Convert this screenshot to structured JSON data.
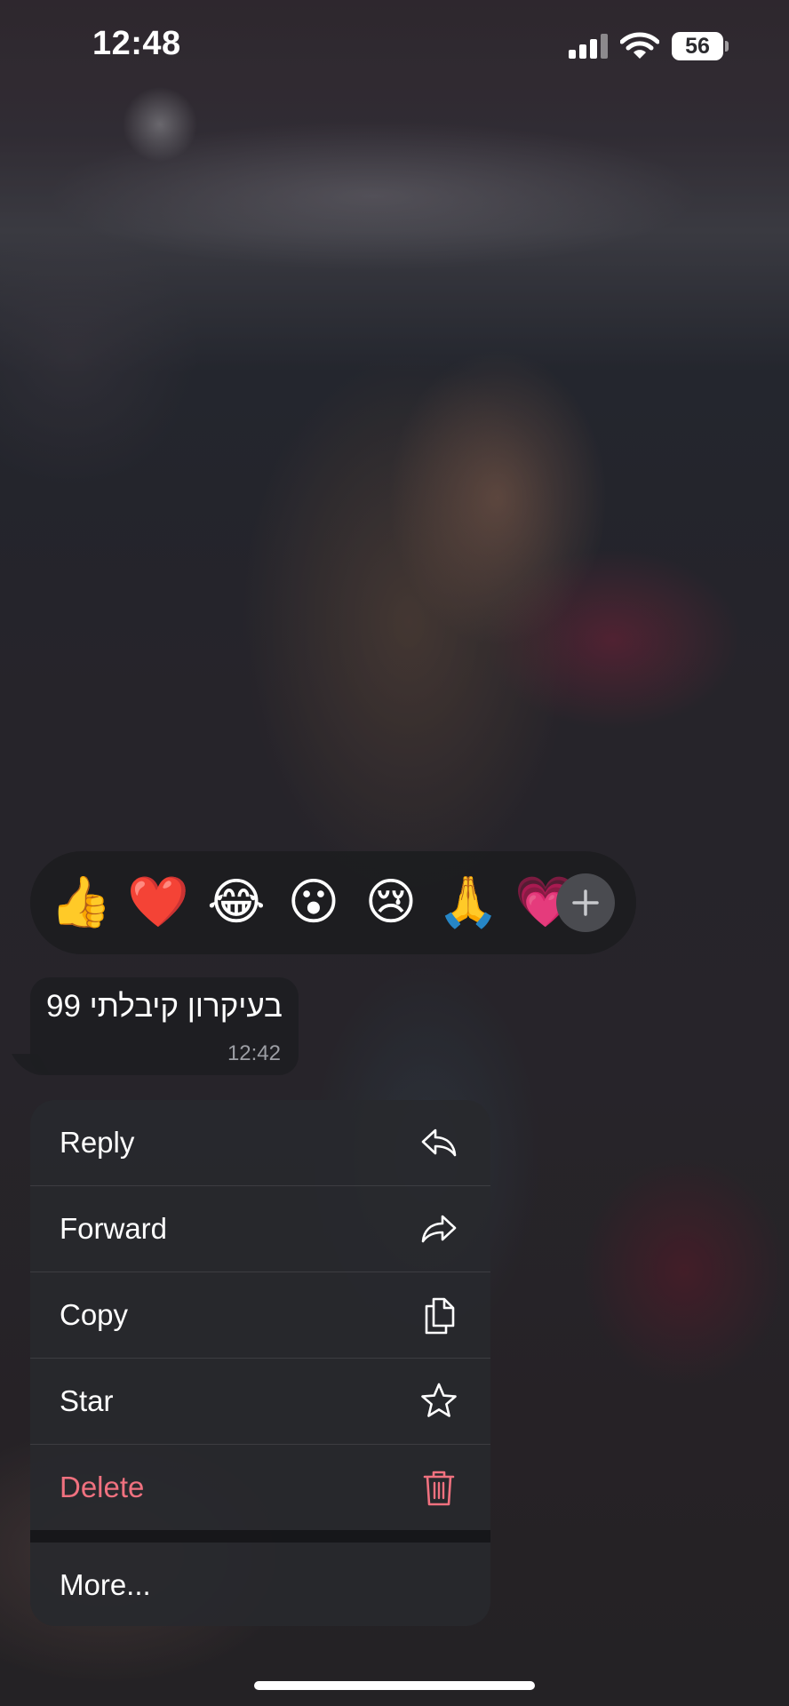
{
  "status_bar": {
    "time": "12:48",
    "battery": "56",
    "signal_icon": "cellular-signal-icon",
    "wifi_icon": "wifi-icon"
  },
  "reactions": {
    "emojis": [
      "👍",
      "❤️",
      "😂",
      "😮",
      "😢",
      "🙏",
      "💗"
    ],
    "more_icon": "plus-icon"
  },
  "message": {
    "text": "בעיקרון קיבלתי 99",
    "time": "12:42"
  },
  "menu": {
    "items": [
      {
        "label": "Reply",
        "icon": "reply-icon"
      },
      {
        "label": "Forward",
        "icon": "forward-icon"
      },
      {
        "label": "Copy",
        "icon": "copy-icon"
      },
      {
        "label": "Star",
        "icon": "star-icon"
      },
      {
        "label": "Delete",
        "icon": "trash-icon"
      },
      {
        "label": "More...",
        "icon": ""
      }
    ],
    "delete_color": "#f0717f"
  }
}
